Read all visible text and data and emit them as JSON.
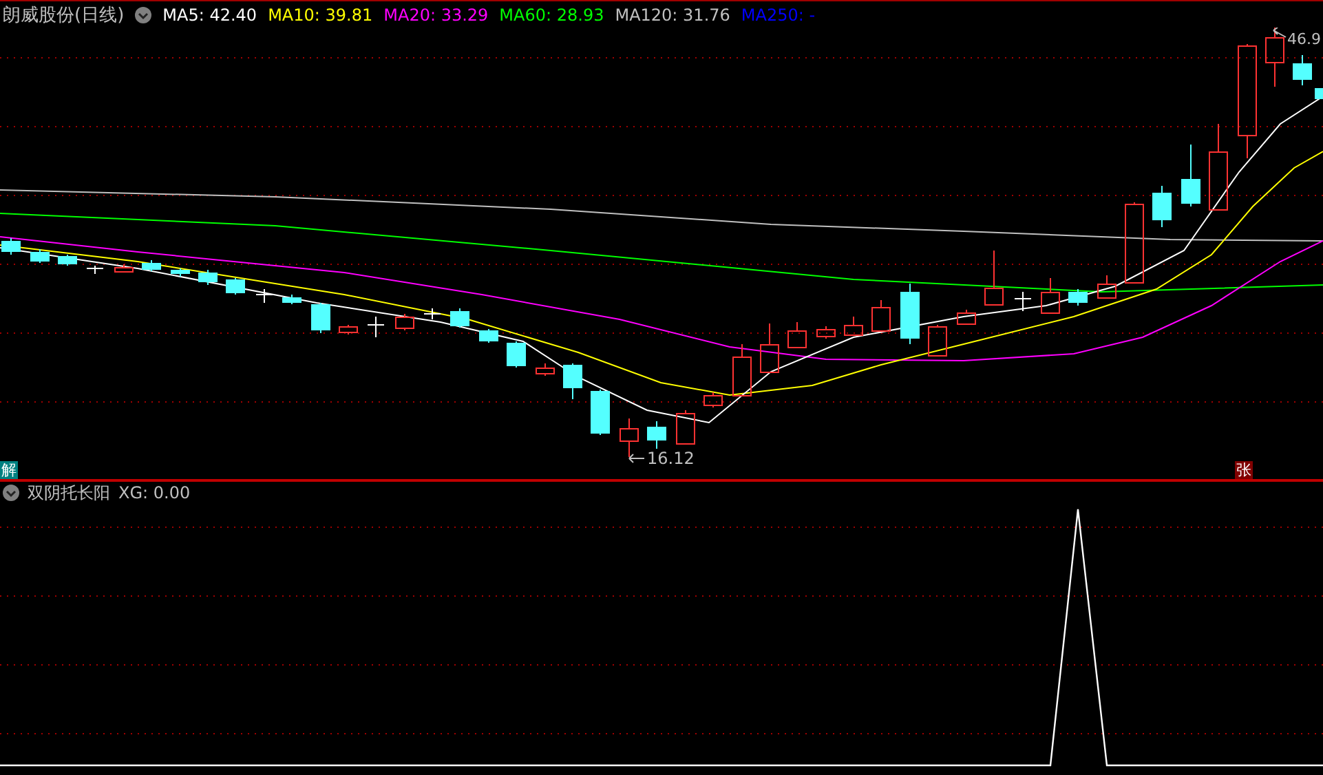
{
  "header": {
    "title": "朗威股份(日线)",
    "indicators": [
      {
        "label": "MA5: 42.40",
        "color": "#ffffff"
      },
      {
        "label": "MA10: 39.81",
        "color": "#ffff00"
      },
      {
        "label": "MA20: 33.29",
        "color": "#ff00ff"
      },
      {
        "label": "MA60: 28.93",
        "color": "#00ff00"
      },
      {
        "label": "MA120: 31.76",
        "color": "#c0c0c0"
      },
      {
        "label": "MA250: -",
        "color": "#0000ff"
      }
    ]
  },
  "price_chart": {
    "high_label": "46.9",
    "low_label": "16.12",
    "badges": [
      {
        "text": "解",
        "color": "#008080"
      },
      {
        "text": "张",
        "color": "#800000"
      }
    ]
  },
  "indicator_panel": {
    "title": "双阴托长阳",
    "reading": "XG: 0.00"
  }
}
